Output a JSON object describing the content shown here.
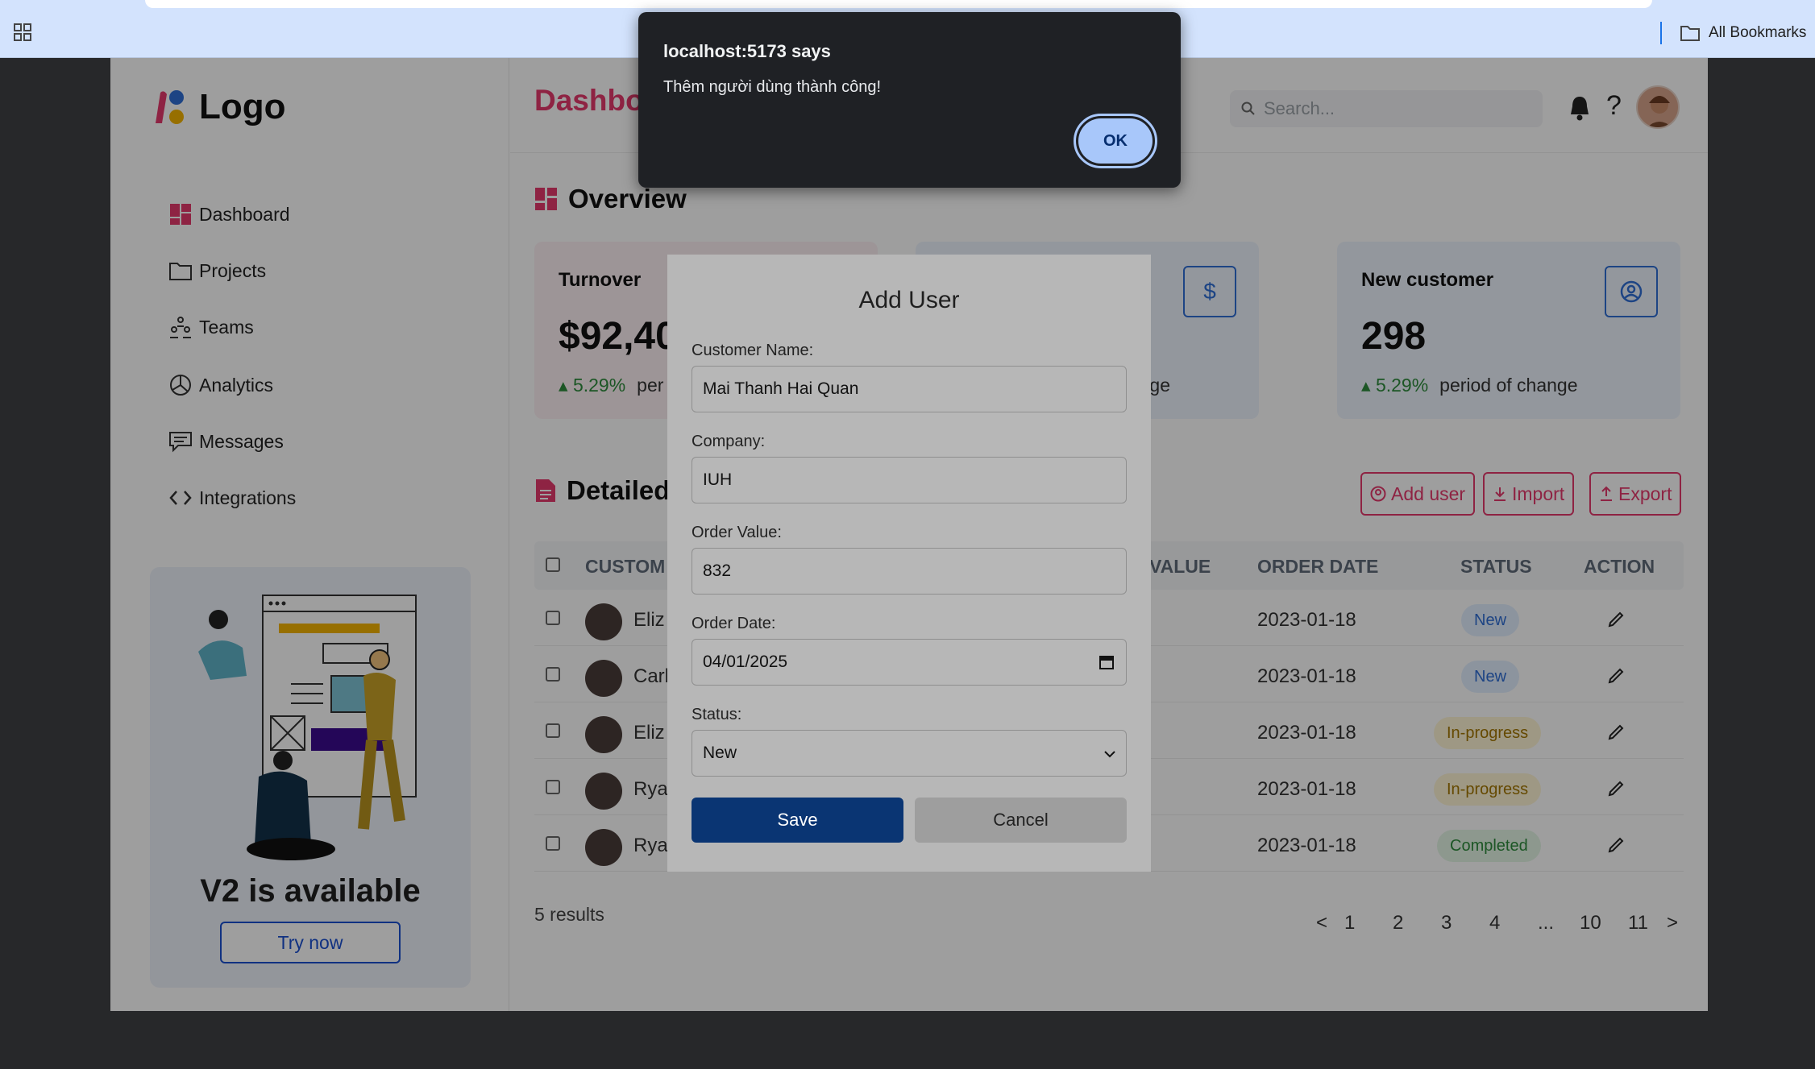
{
  "browser": {
    "all_bookmarks": "All Bookmarks"
  },
  "sidebar": {
    "logo_text": "Logo",
    "items": [
      {
        "label": "Dashboard",
        "icon": "dashboard-icon"
      },
      {
        "label": "Projects",
        "icon": "folder-icon"
      },
      {
        "label": "Teams",
        "icon": "teams-icon"
      },
      {
        "label": "Analytics",
        "icon": "analytics-icon"
      },
      {
        "label": "Messages",
        "icon": "messages-icon"
      },
      {
        "label": "Integrations",
        "icon": "code-icon"
      }
    ],
    "promo": {
      "title": "V2 is available",
      "button": "Try now"
    }
  },
  "header": {
    "title": "Dashbo",
    "search_placeholder": "Search..."
  },
  "overview": {
    "title": "Overview",
    "cards": [
      {
        "title": "Turnover",
        "value": "$92,40",
        "change": "5.29%",
        "change_desc": "per",
        "icon": "cart-icon"
      },
      {
        "title": "",
        "value": "",
        "change": "",
        "change_desc": "ange",
        "icon": "dollar-icon"
      },
      {
        "title": "New customer",
        "value": "298",
        "change": "5.29%",
        "change_desc": "period of change",
        "icon": "user-circle-icon"
      }
    ]
  },
  "detail": {
    "title": "Detailed",
    "buttons": {
      "add": "Add user",
      "import": "Import",
      "export": "Export"
    },
    "columns": {
      "customer": "CUSTOM",
      "value": "VALUE",
      "date": "ORDER DATE",
      "status": "STATUS",
      "action": "ACTION"
    },
    "rows": [
      {
        "name": "Eliz",
        "date": "2023-01-18",
        "status": "New",
        "status_type": "new"
      },
      {
        "name": "Carl",
        "date": "2023-01-18",
        "status": "New",
        "status_type": "new"
      },
      {
        "name": "Eliz",
        "date": "2023-01-18",
        "status": "In-progress",
        "status_type": "prog"
      },
      {
        "name": "Rya",
        "date": "2023-01-18",
        "status": "In-progress",
        "status_type": "prog"
      },
      {
        "name": "Rya",
        "date": "2023-01-18",
        "status": "Completed",
        "status_type": "done"
      }
    ],
    "results": "5 results",
    "pagination": [
      "<",
      "1",
      "2",
      "3",
      "4",
      "...",
      "10",
      "11",
      ">"
    ]
  },
  "modal": {
    "title": "Add User",
    "fields": {
      "name_label": "Customer Name:",
      "name_value": "Mai Thanh Hai Quan",
      "company_label": "Company:",
      "company_value": "IUH",
      "value_label": "Order Value:",
      "value_value": "832",
      "date_label": "Order Date:",
      "date_value": "04/01/2025",
      "status_label": "Status:",
      "status_value": "New"
    },
    "save": "Save",
    "cancel": "Cancel"
  },
  "alert": {
    "title": "localhost:5173 says",
    "message": "Thêm người dùng thành công!",
    "ok": "OK"
  },
  "colors": {
    "accent": "#e6396c",
    "primary_blue": "#2f6fd6",
    "save_button": "#0a3573",
    "alert_ok": "#a8c7fa"
  }
}
